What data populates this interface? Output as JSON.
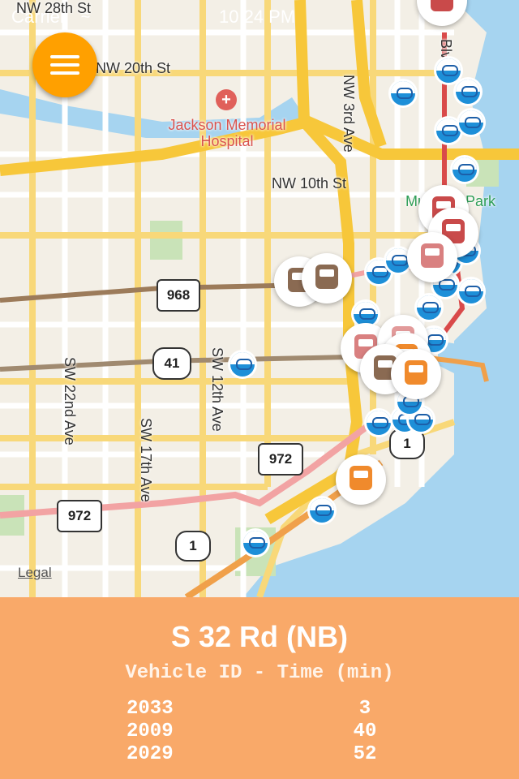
{
  "status_bar": {
    "carrier": "Carrier",
    "time": "10:24 PM"
  },
  "map": {
    "streets": {
      "nw_20th": "NW 20th St",
      "nw_10th": "NW 10th St",
      "nw_3rd_ave": "NW 3rd Ave",
      "sw_22nd_ave": "SW 22nd Ave",
      "sw_17th_ave": "SW 17th Ave",
      "sw_12th_ave": "SW 12th Ave",
      "nw_28th": "NW 28th St",
      "blvd": "Blvd"
    },
    "pois": {
      "hospital": "Jackson Memorial Hospital",
      "park": "Museum Park"
    },
    "shields": [
      "968",
      "41",
      "972",
      "972",
      "1",
      "1"
    ],
    "legal": "Legal"
  },
  "panel": {
    "stop_name": "S 32 Rd (NB)",
    "column_header": "Vehicle ID - Time (min)",
    "rows": [
      {
        "vehicle_id": "2033",
        "time": "3"
      },
      {
        "vehicle_id": "2009",
        "time": "40"
      },
      {
        "vehicle_id": "2029",
        "time": "52"
      }
    ]
  },
  "colors": {
    "panel_bg": "#f9a969",
    "menu_button": "#ffa000",
    "bike_marker": "#1d8fd8",
    "bus_brown": "#8a6a52",
    "bus_red": "#c94a4a",
    "bus_orange": "#f08a2c"
  }
}
